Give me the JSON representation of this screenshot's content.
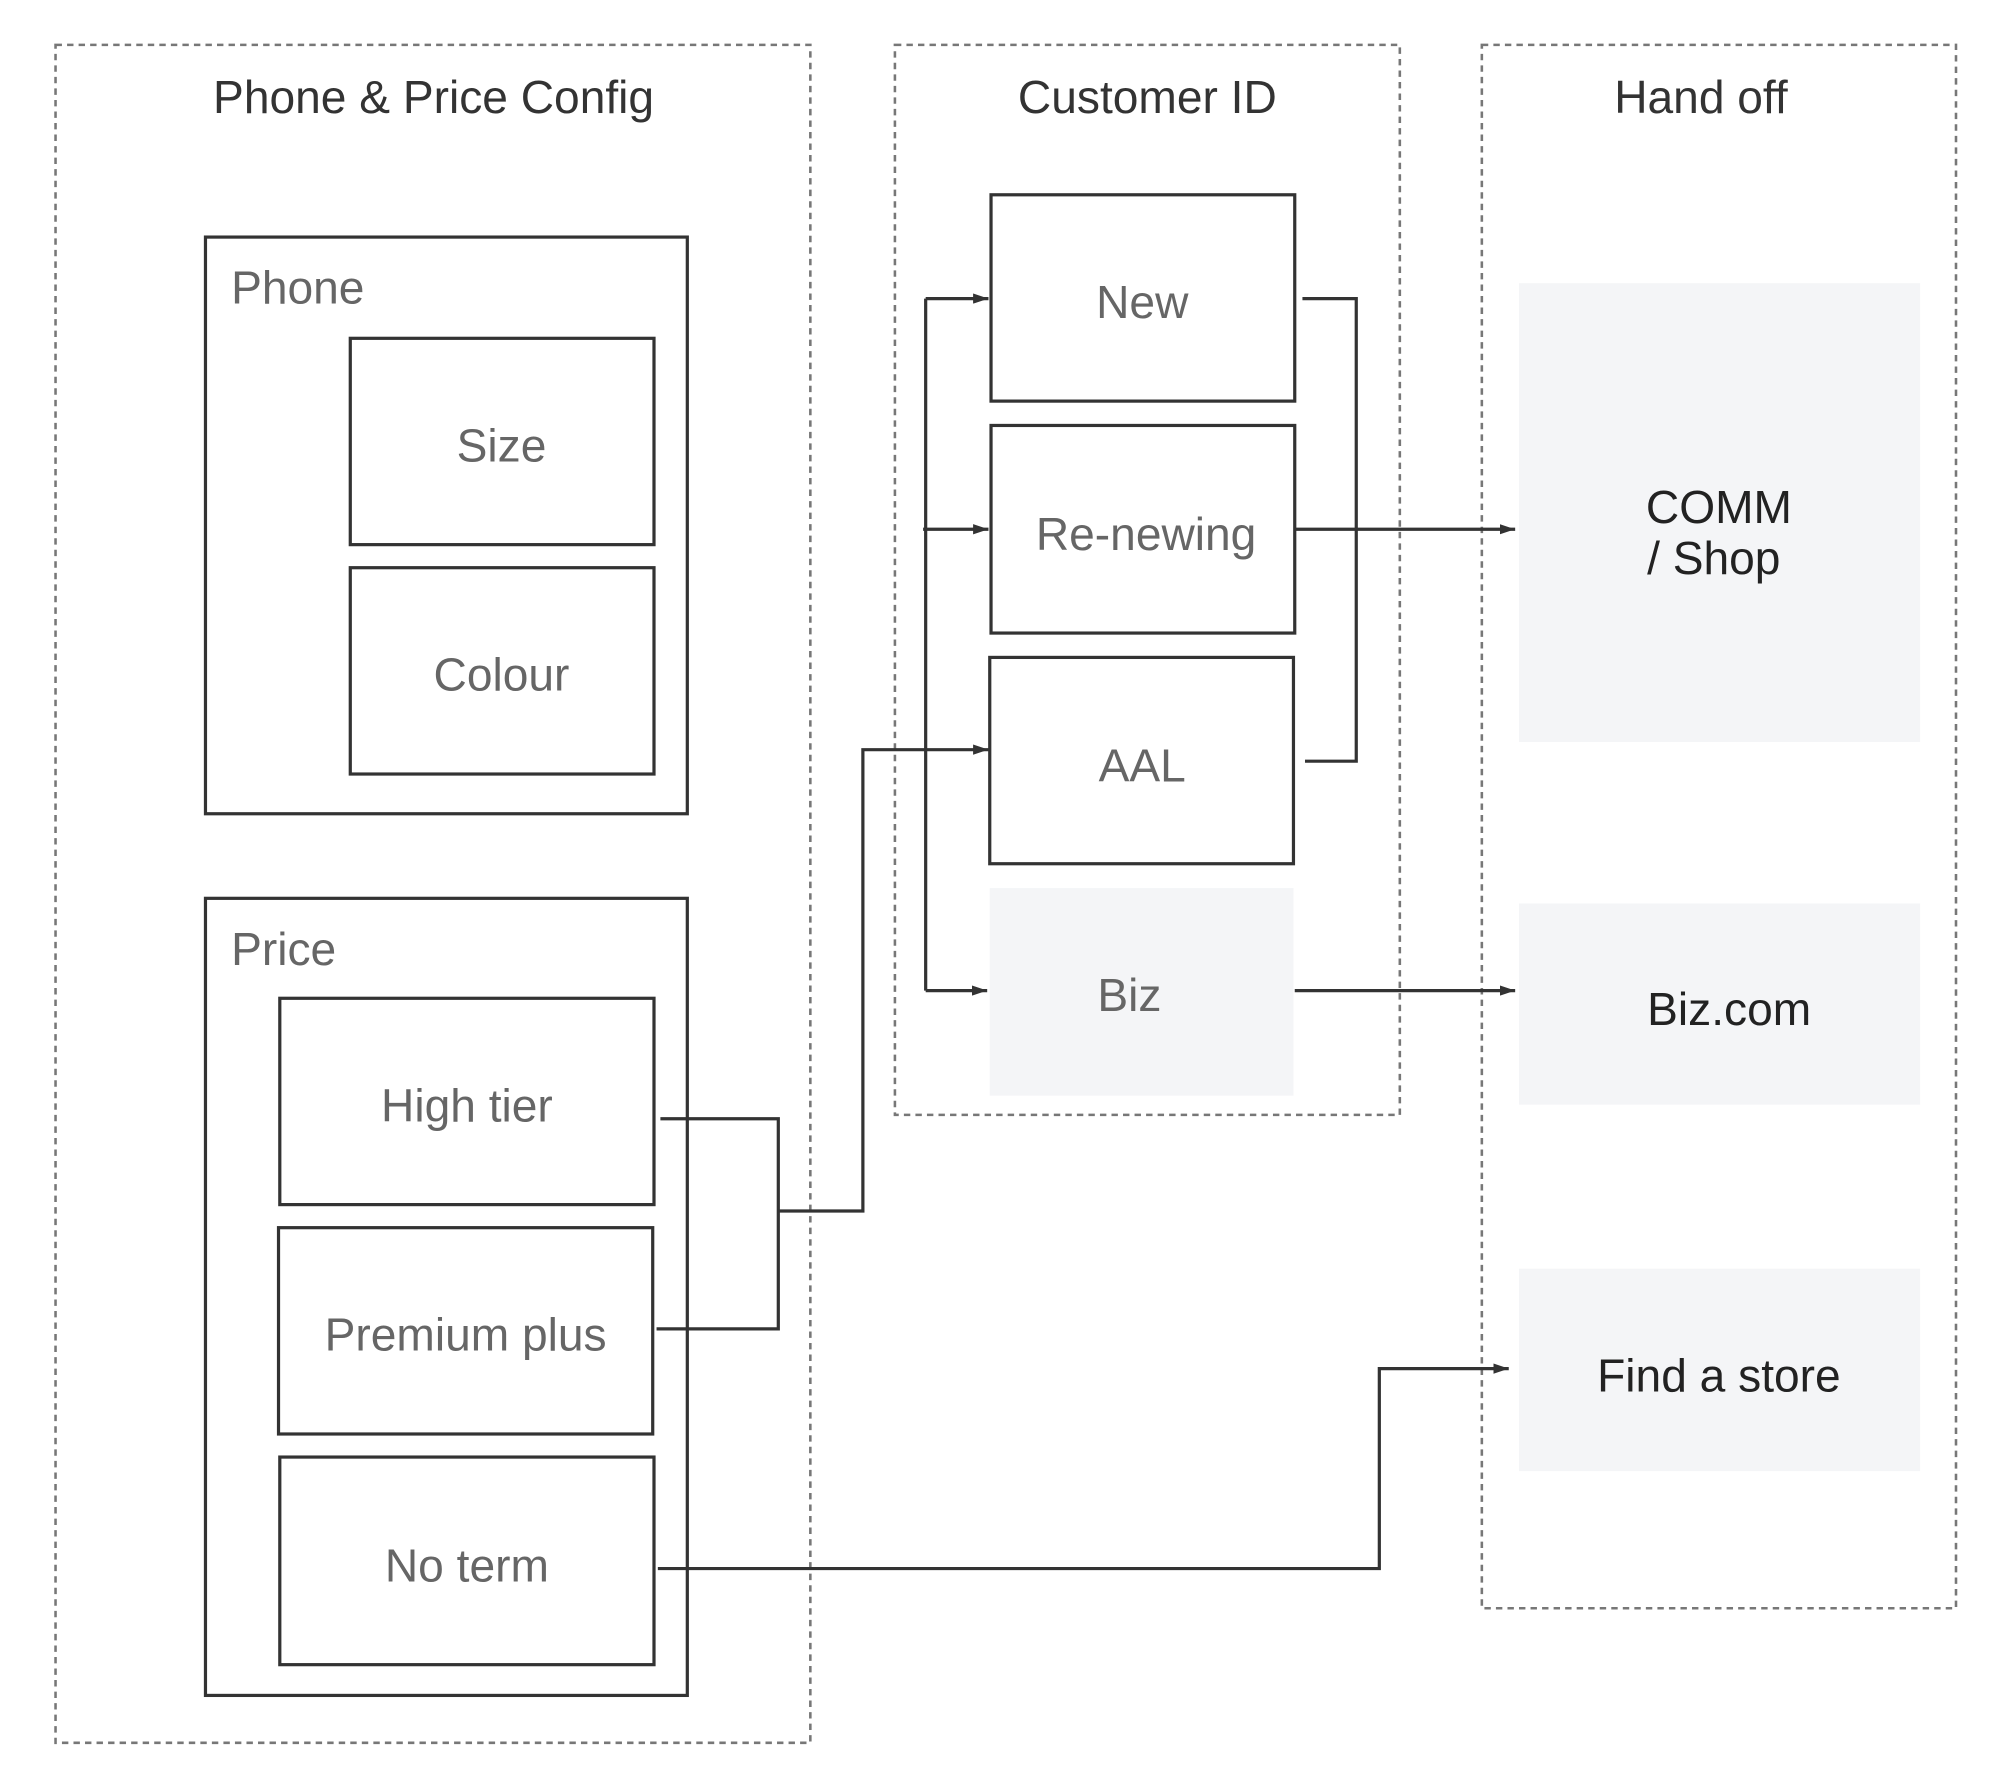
{
  "columns": {
    "config": {
      "title": "Phone & Price Config"
    },
    "customer": {
      "title": "Customer ID"
    },
    "handoff": {
      "title": "Hand off"
    }
  },
  "phone": {
    "label": "Phone",
    "items": [
      "Size",
      "Colour"
    ]
  },
  "price": {
    "label": "Price",
    "items": [
      "High tier",
      "Premium plus",
      "No term"
    ]
  },
  "customer_types": [
    "New",
    "Re-newing",
    "AAL",
    "Biz"
  ],
  "handoff_targets": {
    "comm_line1": "COMM",
    "comm_line2": "/ Shop",
    "biz": "Biz.com",
    "store": "Find a store"
  },
  "colors": {
    "line": "#333333",
    "muted_fill": "#f4f5f7",
    "dashed_border": "#777777"
  }
}
